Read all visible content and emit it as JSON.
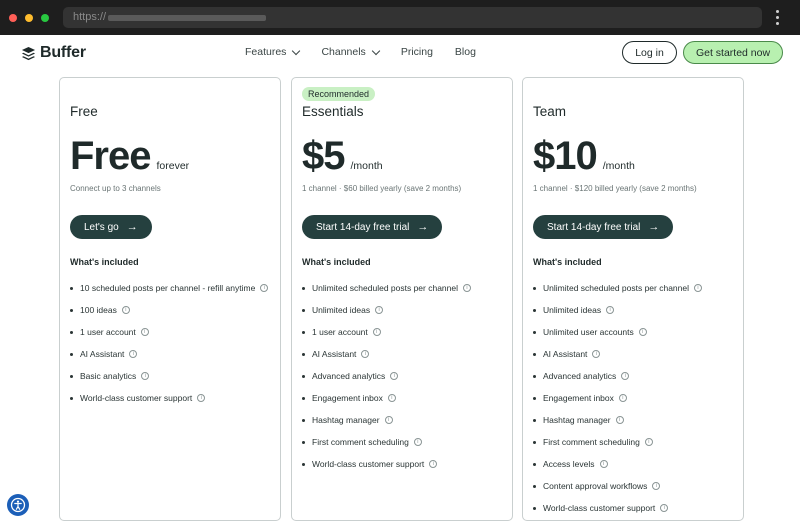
{
  "browser": {
    "url_prefix": "https://"
  },
  "nav": {
    "brand": "Buffer",
    "links": [
      "Features",
      "Channels",
      "Pricing",
      "Blog"
    ],
    "login": "Log in",
    "get_started": "Get started now"
  },
  "plans": [
    {
      "name": "Free",
      "price": "Free",
      "suffix": "forever",
      "sub": "Connect up to 3 channels",
      "cta": "Let's go",
      "included_label": "What's included",
      "features": [
        "10 scheduled posts per channel - refill anytime",
        "100 ideas",
        "1 user account",
        "AI Assistant",
        "Basic analytics",
        "World-class customer support"
      ]
    },
    {
      "badge": "Recommended",
      "name": "Essentials",
      "price": "$5",
      "suffix": "/month",
      "sub": "1 channel · $60 billed yearly (save 2 months)",
      "cta": "Start 14-day free trial",
      "included_label": "What's included",
      "features": [
        "Unlimited scheduled posts per channel",
        "Unlimited ideas",
        "1 user account",
        "AI Assistant",
        "Advanced analytics",
        "Engagement inbox",
        "Hashtag manager",
        "First comment scheduling",
        "World-class customer support"
      ]
    },
    {
      "name": "Team",
      "price": "$10",
      "suffix": "/month",
      "sub": "1 channel · $120 billed yearly (save 2 months)",
      "cta": "Start 14-day free trial",
      "included_label": "What's included",
      "features": [
        "Unlimited scheduled posts per channel",
        "Unlimited ideas",
        "Unlimited user accounts",
        "AI Assistant",
        "Advanced analytics",
        "Engagement inbox",
        "Hashtag manager",
        "First comment scheduling",
        "Access levels",
        "Content approval workflows",
        "World-class customer support"
      ]
    }
  ],
  "colors": {
    "cta_bg": "#25403f",
    "primary_button_bg": "#b8f0b0",
    "badge_bg": "#c9f0c4",
    "accessibility_button": "#1c5fb8"
  },
  "icons": {
    "info": "info-icon",
    "arrow": "arrow-right-icon",
    "logo": "buffer-logo-icon",
    "accessibility": "accessibility-icon"
  }
}
